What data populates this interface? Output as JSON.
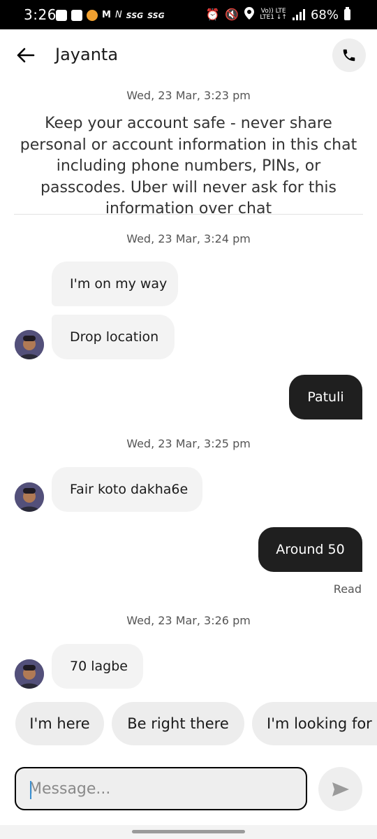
{
  "status_bar": {
    "time": "3:26",
    "left_text_1": "SSG",
    "left_text_2": "SSG",
    "lte_top": "Vo)) LTE",
    "lte_bottom": "LTE1 ↓↑",
    "battery_percent": "68%"
  },
  "header": {
    "contact_name": "Jayanta"
  },
  "chat": {
    "timestamps": [
      "Wed, 23 Mar, 3:23 pm",
      "Wed, 23 Mar, 3:24 pm",
      "Wed, 23 Mar, 3:25 pm",
      "Wed, 23 Mar, 3:26 pm"
    ],
    "safety_notice": "Keep your account safe - never share personal or account information in this chat including phone numbers, PINs, or passcodes. Uber will never ask for this information over chat",
    "messages": [
      {
        "from": "driver",
        "text": "I'm on my way"
      },
      {
        "from": "driver",
        "text": "Drop location"
      },
      {
        "from": "me",
        "text": "Patuli"
      },
      {
        "from": "driver",
        "text": "Fair koto dakha6e"
      },
      {
        "from": "me",
        "text": "Around 50"
      },
      {
        "from": "driver",
        "text": "70 lagbe"
      }
    ],
    "read_receipt": "Read"
  },
  "quick_replies": [
    "I'm here",
    "Be right there",
    "I'm looking for you"
  ],
  "composer": {
    "placeholder": "Message..."
  },
  "icons": {
    "back": "arrow-left-icon",
    "call": "phone-icon",
    "send": "send-icon"
  }
}
